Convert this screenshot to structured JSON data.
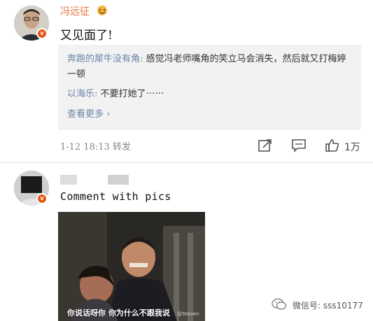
{
  "post1": {
    "username": "冯远征",
    "text": "又见面了!",
    "comments": [
      {
        "name": "奔跑的犀牛没有角:",
        "text": " 感觉冯老师嘴角的笑立马会消失，然后就又打梅婷一顿"
      },
      {
        "name": "以海乐:",
        "text": " 不要打她了⋯⋯"
      }
    ],
    "see_more": "查看更多 ›",
    "timestamp": "1-12 18:13",
    "repost_label": "转发",
    "like_count": "1万"
  },
  "post2": {
    "text": "Comment with pics",
    "image_subtitle": "你说话呀你 你为什么不跟我说",
    "image_credit": "@Steven"
  },
  "watermark": {
    "text": "微信号: sss10177"
  },
  "colors": {
    "username": "#e8733b",
    "link": "#6b83a8",
    "badge": "#e5581c"
  }
}
